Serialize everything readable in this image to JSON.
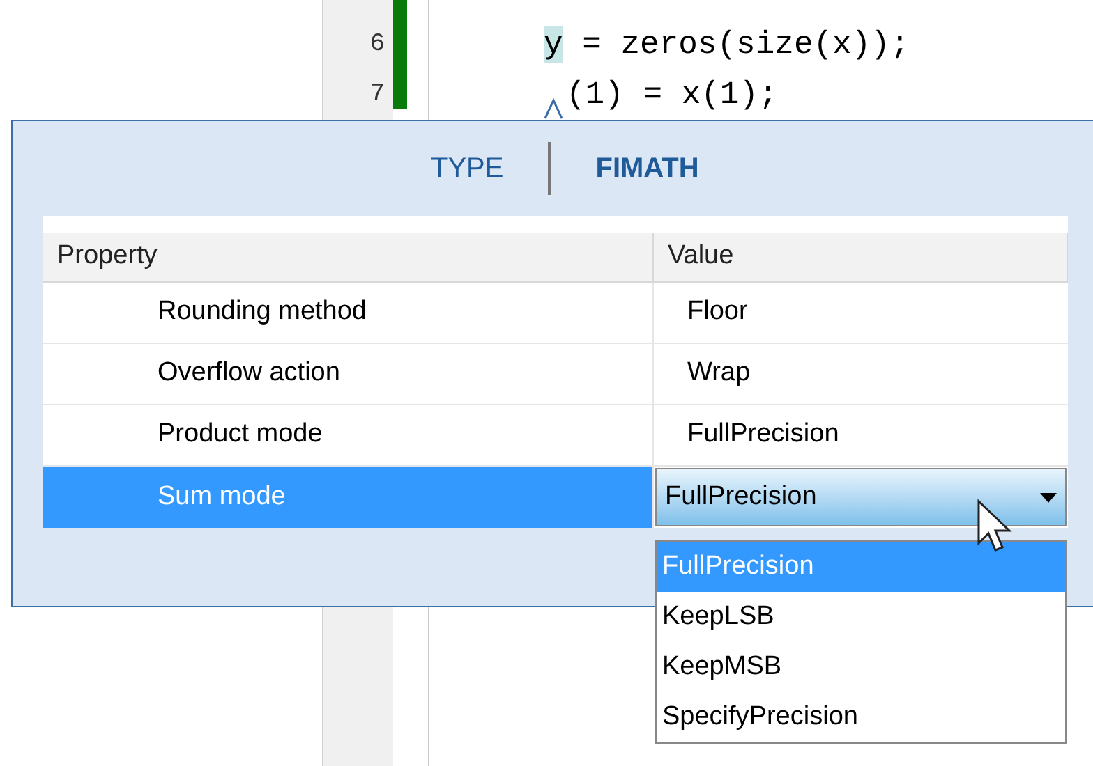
{
  "editor": {
    "lines": [
      {
        "number": "6",
        "segments": [
          {
            "text": "y",
            "kind": "highlight"
          },
          {
            "text": " = zeros(size(x));",
            "kind": "plain"
          }
        ]
      },
      {
        "number": "7",
        "pointer": true,
        "segments": [
          {
            "text": "(1) = x(1);",
            "kind": "plain"
          }
        ]
      }
    ]
  },
  "panel": {
    "tabs": [
      {
        "label": "TYPE",
        "selected": false
      },
      {
        "label": "FIMATH",
        "selected": true
      }
    ],
    "table": {
      "columns": [
        "Property",
        "Value"
      ],
      "rows": [
        {
          "property": "Rounding method",
          "value": "Floor",
          "selected": false
        },
        {
          "property": "Overflow action",
          "value": "Wrap",
          "selected": false
        },
        {
          "property": "Product mode",
          "value": "FullPrecision",
          "selected": false
        },
        {
          "property": "Sum mode",
          "value": "FullPrecision",
          "selected": true
        }
      ]
    }
  },
  "dropdown": {
    "options": [
      {
        "label": "FullPrecision",
        "selected": true
      },
      {
        "label": "KeepLSB",
        "selected": false
      },
      {
        "label": "KeepMSB",
        "selected": false
      },
      {
        "label": "SpecifyPrecision",
        "selected": false
      }
    ]
  }
}
